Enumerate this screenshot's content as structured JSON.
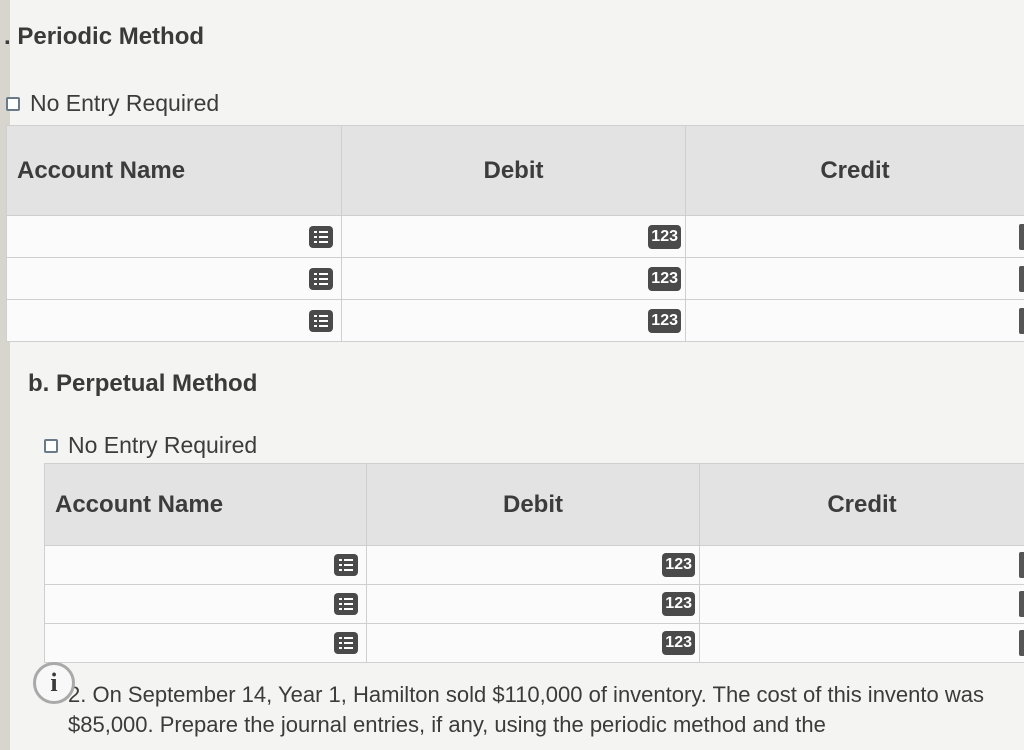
{
  "sections": {
    "periodic": {
      "title": ". Periodic Method",
      "no_entry_label": "No Entry Required",
      "headers": {
        "account": "Account Name",
        "debit": "Debit",
        "credit": "Credit"
      },
      "rows": [
        {
          "account": "",
          "debit": "",
          "credit": ""
        },
        {
          "account": "",
          "debit": "",
          "credit": ""
        },
        {
          "account": "",
          "debit": "",
          "credit": ""
        }
      ],
      "debit_icon_text": "123"
    },
    "perpetual": {
      "title": "b. Perpetual Method",
      "no_entry_label": "No Entry Required",
      "headers": {
        "account": "Account Name",
        "debit": "Debit",
        "credit": "Credit"
      },
      "rows": [
        {
          "account": "",
          "debit": "",
          "credit": ""
        },
        {
          "account": "",
          "debit": "",
          "credit": ""
        },
        {
          "account": "",
          "debit": "",
          "credit": ""
        }
      ],
      "debit_icon_text": "123"
    }
  },
  "info": {
    "icon_text": "i",
    "question": "2. On September 14, Year 1, Hamilton sold $110,000 of inventory. The cost of this invento was $85,000. Prepare the journal entries, if any, using the periodic method and the"
  },
  "icons": {
    "account_dropdown": "list-icon",
    "debit_input": "numeric-input-icon",
    "info": "info-icon"
  },
  "colors": {
    "header_bg": "#e3e3e3",
    "icon_bg": "#4a4a4a",
    "text": "#333333"
  }
}
